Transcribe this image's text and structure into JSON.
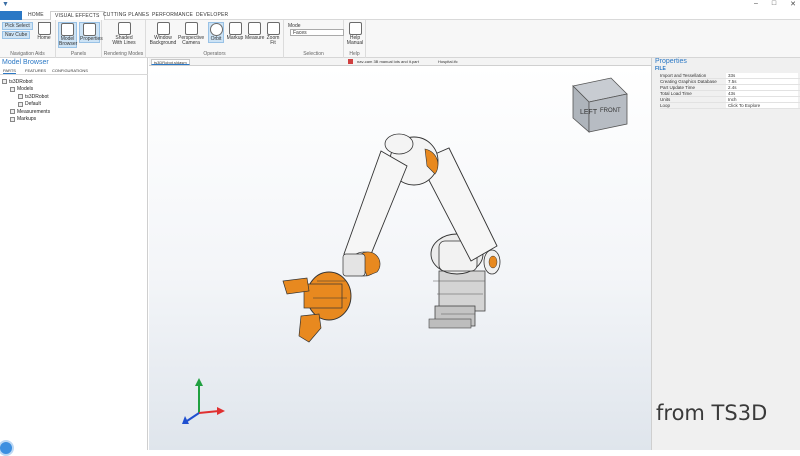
{
  "titlebar": {
    "left_glyph": "▼",
    "controls": [
      "–",
      "□",
      "✕"
    ]
  },
  "ribbon_tabs": [
    {
      "label": "HOME",
      "active": false
    },
    {
      "label": "VISUAL EFFECTS",
      "active": true
    },
    {
      "label": "CUTTING PLANES",
      "active": false
    },
    {
      "label": "PERFORMANCE",
      "active": false
    },
    {
      "label": "DEVELOPER",
      "active": false
    }
  ],
  "ribbon": {
    "nav_aids": {
      "btn1": "Pick Select",
      "btn2": "Nav Cube",
      "home": "Home",
      "label": "Navigation Aids"
    },
    "panels": {
      "model_browser": "Model Browser",
      "properties": "Properties",
      "label": "Panels"
    },
    "rendering": {
      "shaded": "Shaded With Lines",
      "label": "Rendering Modes"
    },
    "operators": {
      "window_background": "Window Background",
      "perspective_camera": "Perspective Camera",
      "orbit": "Orbit",
      "markup": "Markup",
      "measure": "Measure",
      "zoom_fit": "Zoom Fit",
      "label": "Operators"
    },
    "selection": {
      "mode_label": "Mode",
      "mode_value": "Faces",
      "label": "Selection"
    },
    "help": {
      "manual": "Help Manual",
      "label": "Help"
    }
  },
  "model_browser": {
    "title": "Model Browser",
    "tabs": [
      "PARTS",
      "FEATURES",
      "CONFIGURATIONS"
    ],
    "tree": [
      {
        "label": "ts3DRobot",
        "indent": 0
      },
      {
        "label": "Models",
        "indent": 1
      },
      {
        "label": "ts3DRobot",
        "indent": 2
      },
      {
        "label": "Default",
        "indent": 2
      },
      {
        "label": "Measurements",
        "indent": 1
      },
      {
        "label": "Markups",
        "indent": 1
      }
    ]
  },
  "doc_tabs": [
    {
      "label": "ts3DRobot.sldasm",
      "active": true
    },
    {
      "label": "nav-cam 3B manual lots and it.part",
      "active": false
    },
    {
      "label": "Hospital.ifc",
      "active": false
    }
  ],
  "navcube": {
    "front": "FRONT",
    "left": "LEFT"
  },
  "properties": {
    "title": "Properties",
    "section": "FILE",
    "rows": [
      {
        "key": "Import and Tessellation",
        "value": "33s"
      },
      {
        "key": "Creating Graphics Database",
        "value": "7.5s"
      },
      {
        "key": "Part Update Time",
        "value": "2.4s"
      },
      {
        "key": "Total Load Time",
        "value": "43s"
      },
      {
        "key": "Units",
        "value": "Inch"
      },
      {
        "key": "Loop",
        "value": "Click To Explore"
      }
    ]
  },
  "watermark": "from TS3D",
  "colors": {
    "accent": "#2b78c5",
    "robot_orange": "#e8891f",
    "axis_x": "#e03030",
    "axis_y": "#20a040",
    "axis_z": "#2050d0"
  }
}
